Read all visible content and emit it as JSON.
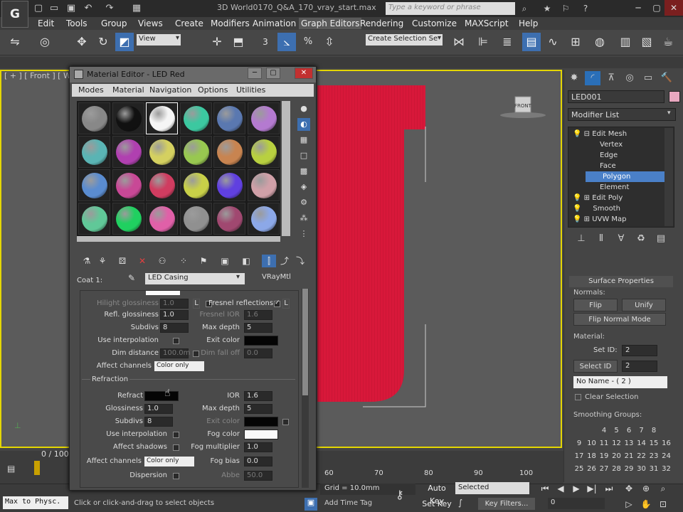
{
  "app": {
    "logo": "G",
    "file_title": "3D World0170_Q&A_170_vray_start.max",
    "search_placeholder": "Type a keyword or phrase",
    "quick_access": [
      "new-icon",
      "open-icon",
      "save-icon",
      "undo-icon",
      "redo-icon",
      "project-icon"
    ]
  },
  "menu": [
    "Edit",
    "Tools",
    "Group",
    "Views",
    "Create",
    "Modifiers",
    "Animation",
    "Graph Editors",
    "Rendering",
    "Customize",
    "MAXScript",
    "Help"
  ],
  "toolbar": {
    "view_dropdown": "View",
    "snap_3": "3",
    "named_selection": "Create Selection Se"
  },
  "viewport": {
    "label": "[ + ] [ Front ] [ Wire",
    "viewcube_label": "FRONT",
    "model_color": "#d8183a",
    "border_color": "#e4d600"
  },
  "material_editor": {
    "title": "Material Editor - LED Red",
    "menus": [
      "Modes",
      "Material",
      "Navigation",
      "Options",
      "Utilities"
    ],
    "spheres": [
      [
        "#888888",
        "#111111",
        "#f5f5f5",
        "#3cc8a0",
        "#5a78b0",
        "#b47ad0"
      ],
      [
        "#5ab4b4",
        "#b040b0",
        "#d4d060",
        "#98c850",
        "#c88450",
        "#b8d040"
      ],
      [
        "#5a8cd0",
        "#c84896",
        "#d03c60",
        "#c8d048",
        "#6040e0",
        "#d0a0a8"
      ],
      [
        "#60c898",
        "#20d060",
        "#e060a8",
        "#909090",
        "#a04870",
        "#8ca8e8"
      ]
    ],
    "coat_label": "Coat 1:",
    "material_name": "LED Casing",
    "material_type": "VRayMtl",
    "reflection": {
      "hilight_gloss_label": "Hilight glossiness",
      "hilight_gloss": "1.0",
      "refl_gloss_label": "Refl. glossiness",
      "refl_gloss": "1.0",
      "subdivs_label": "Subdivs",
      "subdivs": "8",
      "use_interp_label": "Use interpolation",
      "dim_distance_label": "Dim distance",
      "dim_distance": "100.0m",
      "affect_channels_label": "Affect channels",
      "affect_channels": "Color only",
      "lock_label": "L",
      "fresnel_label": "Fresnel reflections",
      "fresnel_lock": "L",
      "fresnel_ior_label": "Fresnel IOR",
      "fresnel_ior": "1.6",
      "max_depth_label": "Max depth",
      "max_depth": "5",
      "exit_color_label": "Exit color",
      "dim_falloff_label": "Dim fall off",
      "dim_falloff": "0.0"
    },
    "refraction": {
      "section": "Refraction",
      "refract_label": "Refract",
      "ior_label": "IOR",
      "ior": "1.6",
      "glossiness_label": "Glossiness",
      "glossiness": "1.0",
      "max_depth_label": "Max depth",
      "max_depth": "5",
      "subdivs_label": "Subdivs",
      "subdivs": "8",
      "exit_color_label": "Exit color",
      "use_interp_label": "Use interpolation",
      "fog_color_label": "Fog color",
      "affect_shadows_label": "Affect shadows",
      "fog_mult_label": "Fog multiplier",
      "fog_mult": "1.0",
      "affect_channels_label": "Affect channels",
      "affect_channels": "Color only",
      "fog_bias_label": "Fog bias",
      "fog_bias": "0.0",
      "dispersion_label": "Dispersion",
      "abbe_label": "Abbe",
      "abbe": "50.0"
    }
  },
  "command_panel": {
    "object_name": "LED001",
    "object_color": "#e8a8c0",
    "modifier_list": "Modifier List",
    "stack": [
      "Edit Mesh",
      "Vertex",
      "Edge",
      "Face",
      "Polygon",
      "Element",
      "Edit Poly",
      "Smooth",
      "UVW Map"
    ],
    "selected_stack_item": "Polygon",
    "surface_properties": "Surface Properties",
    "normals_label": "Normals:",
    "flip": "Flip",
    "unify": "Unify",
    "flip_normal_mode": "Flip Normal Mode",
    "material_label": "Material:",
    "set_id_label": "Set ID:",
    "set_id": "2",
    "select_id": "Select ID",
    "select_id_value": "2",
    "no_name": "No Name - ( 2 )",
    "clear_selection": "Clear Selection",
    "smoothing_groups": "Smoothing Groups:",
    "sg_rows": [
      [
        "",
        "",
        "4",
        "5",
        "6",
        "7",
        "8"
      ],
      [
        "9",
        "10",
        "11",
        "12",
        "13",
        "14",
        "15",
        "16"
      ],
      [
        "17",
        "18",
        "19",
        "20",
        "21",
        "22",
        "23",
        "24"
      ],
      [
        "25",
        "26",
        "27",
        "28",
        "29",
        "30",
        "31",
        "32"
      ]
    ]
  },
  "timeline": {
    "counter": "0 / 100",
    "ticks": [
      "60",
      "70",
      "80",
      "90",
      "100"
    ]
  },
  "status": {
    "listener": "Max to Physc.",
    "message": "Click or click-and-drag to select objects",
    "grid": "Grid = 10.0mm",
    "add_time_tag": "Add Time Tag",
    "auto_key": "Auto Key",
    "set_key": "Set Key",
    "selected": "Selected",
    "key_filters": "Key Filters...",
    "frame": "0"
  }
}
